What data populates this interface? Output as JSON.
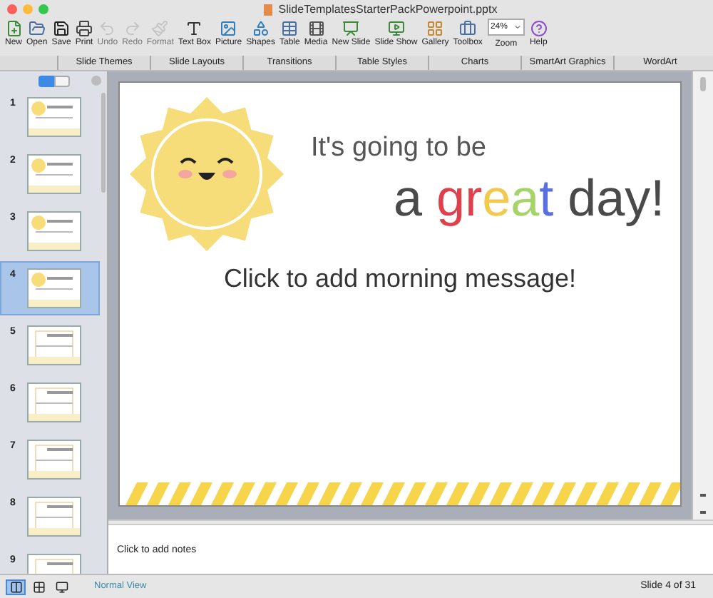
{
  "window": {
    "title": "SlideTemplatesStarterPackPowerpoint.pptx"
  },
  "toolbar": [
    {
      "kind": "button",
      "label": "New",
      "disabled": false
    },
    {
      "kind": "button",
      "label": "Open",
      "disabled": false
    },
    {
      "kind": "button",
      "label": "Save",
      "disabled": false
    },
    {
      "kind": "button",
      "label": "Print",
      "disabled": false
    },
    {
      "kind": "button",
      "label": "Undo",
      "disabled": true
    },
    {
      "kind": "button",
      "label": "Redo",
      "disabled": true
    },
    {
      "kind": "button",
      "label": "Format",
      "disabled": true
    },
    {
      "kind": "button",
      "label": "Text Box",
      "disabled": false
    },
    {
      "kind": "button",
      "label": "Picture",
      "disabled": false
    },
    {
      "kind": "button",
      "label": "Shapes",
      "disabled": false
    },
    {
      "kind": "button",
      "label": "Table",
      "disabled": false
    },
    {
      "kind": "button",
      "label": "Media",
      "disabled": false
    },
    {
      "kind": "button",
      "label": "New Slide",
      "disabled": false
    },
    {
      "kind": "button",
      "label": "Slide Show",
      "disabled": false
    },
    {
      "kind": "button",
      "label": "Gallery",
      "disabled": false
    },
    {
      "kind": "button",
      "label": "Toolbox",
      "disabled": false
    },
    {
      "kind": "zoom",
      "label": "Zoom",
      "value": "24%"
    },
    {
      "kind": "button",
      "label": "Help",
      "disabled": false
    }
  ],
  "ribbon_tabs": [
    "Slide Themes",
    "Slide Layouts",
    "Transitions",
    "Table Styles",
    "Charts",
    "SmartArt Graphics",
    "WordArt"
  ],
  "slides": [
    {
      "number": "1",
      "selected": false
    },
    {
      "number": "2",
      "selected": false
    },
    {
      "number": "3",
      "selected": false
    },
    {
      "number": "4",
      "selected": true
    },
    {
      "number": "5",
      "selected": false
    },
    {
      "number": "6",
      "selected": false
    },
    {
      "number": "7",
      "selected": false
    },
    {
      "number": "8",
      "selected": false
    },
    {
      "number": "9",
      "selected": false
    }
  ],
  "slide": {
    "line_1": "It's going to be",
    "line_2": [
      {
        "text": "a ",
        "color": "#4a4a4a"
      },
      {
        "text": "g",
        "color": "#e0404c"
      },
      {
        "text": "r",
        "color": "#e0404c"
      },
      {
        "text": "e",
        "color": "#f2c94c"
      },
      {
        "text": "a",
        "color": "#a6d46a"
      },
      {
        "text": "t",
        "color": "#5a6fe0"
      },
      {
        "text": " day!",
        "color": "#4a4a4a"
      }
    ],
    "placeholder": "Click to add morning message!"
  },
  "notes": {
    "placeholder": "Click to add notes"
  },
  "status_bar": {
    "views": [
      {
        "selected": true
      },
      {
        "selected": false
      },
      {
        "selected": false
      }
    ],
    "view_name": "Normal View",
    "slide_position": "Slide 4 of 31"
  }
}
